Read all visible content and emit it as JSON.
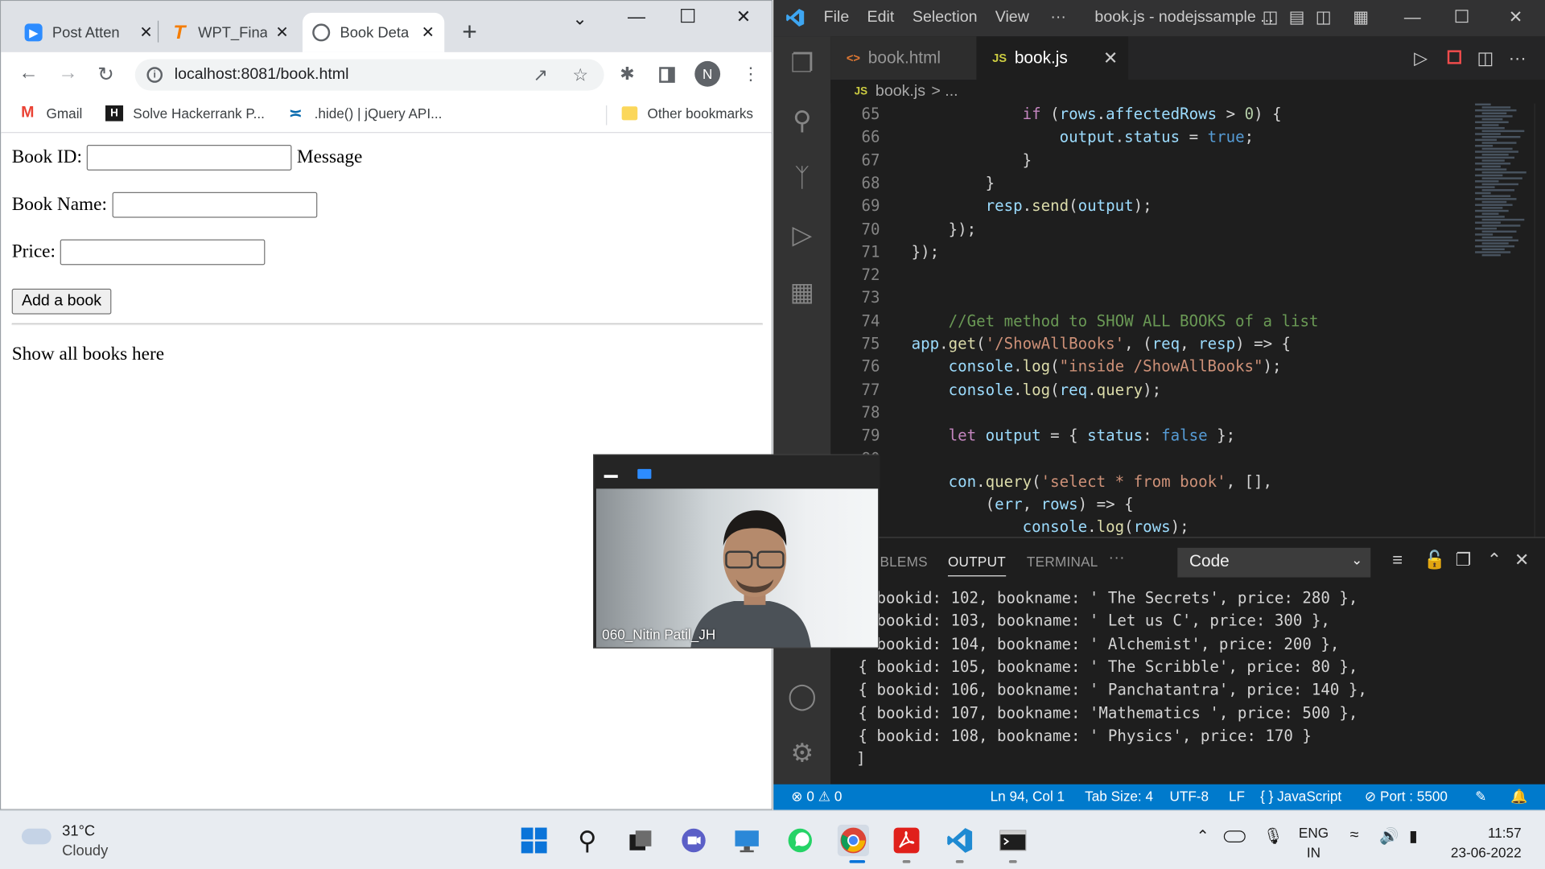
{
  "browser": {
    "tabs": [
      {
        "label": "Post Atten",
        "icon": "zoom-icon"
      },
      {
        "label": "WPT_Final",
        "icon": "testbook-icon"
      },
      {
        "label": "Book Deta",
        "icon": "globe-icon"
      }
    ],
    "url": "localhost:8081/book.html",
    "profile_initial": "N",
    "bookmarks": [
      {
        "label": "Gmail",
        "icon": "gmail-icon"
      },
      {
        "label": "Solve Hackerrank P...",
        "icon": "hackerrank-icon"
      },
      {
        "label": ".hide() | jQuery API...",
        "icon": "jquery-icon"
      }
    ],
    "other_bookmarks": "Other bookmarks"
  },
  "form": {
    "book_id_label": "Book ID:",
    "message_label": "Message",
    "book_name_label": "Book Name:",
    "price_label": "Price:",
    "book_id_value": "",
    "book_name_value": "",
    "price_value": "",
    "add_button": "Add a book",
    "show_all_text": "Show all books here"
  },
  "vscode": {
    "menu": [
      "File",
      "Edit",
      "Selection",
      "View",
      "···"
    ],
    "title": "book.js - nodejssample ...",
    "tabs": [
      {
        "label": "book.html",
        "icon": "<>"
      },
      {
        "label": "book.js",
        "icon": "JS"
      }
    ],
    "breadcrumb_file": "book.js",
    "breadcrumb_rest": "> ...",
    "code_lines": [
      {
        "n": "65",
        "text": "            if (rows.affectedRows > 0) {"
      },
      {
        "n": "66",
        "text": "                output.status = true;"
      },
      {
        "n": "67",
        "text": "            }"
      },
      {
        "n": "68",
        "text": "        }"
      },
      {
        "n": "69",
        "text": "        resp.send(output);"
      },
      {
        "n": "70",
        "text": "    });"
      },
      {
        "n": "71",
        "text": "});"
      },
      {
        "n": "72",
        "text": ""
      },
      {
        "n": "73",
        "text": ""
      },
      {
        "n": "74",
        "text": "    //Get method to SHOW ALL BOOKS of a list"
      },
      {
        "n": "75",
        "text": "app.get('/ShowAllBooks', (req, resp) => {"
      },
      {
        "n": "76",
        "text": "    console.log(\"inside /ShowAllBooks\");"
      },
      {
        "n": "77",
        "text": "    console.log(req.query);"
      },
      {
        "n": "78",
        "text": ""
      },
      {
        "n": "79",
        "text": "    let output = { status: false };"
      },
      {
        "n": "80",
        "text": ""
      },
      {
        "n": "",
        "text": "    con.query('select * from book', [],"
      },
      {
        "n": "",
        "text": "        (err, rows) => {"
      },
      {
        "n": "",
        "text": "            console.log(rows);"
      }
    ],
    "panel_tabs": [
      "BLEMS",
      "OUTPUT",
      "TERMINAL",
      "···"
    ],
    "output_channel": "Code",
    "output_lines": [
      "  bookid: 102, bookname: ' The Secrets', price: 280 },",
      "  bookid: 103, bookname: ' Let us C', price: 300 },",
      "  bookid: 104, bookname: ' Alchemist', price: 200 },",
      "{ bookid: 105, bookname: ' The Scribble', price: 80 },",
      "{ bookid: 106, bookname: ' Panchatantra', price: 140 },",
      "{ bookid: 107, bookname: 'Mathematics ', price: 500 },",
      "{ bookid: 108, bookname: ' Physics', price: 170 }",
      "]"
    ],
    "status": {
      "problems": "⊗ 0 ⚠ 0",
      "position": "Ln 94, Col 1",
      "tab_size": "Tab Size: 4",
      "encoding": "UTF-8",
      "eol": "LF",
      "language": "{ } JavaScript",
      "port": "⊘ Port : 5500"
    }
  },
  "video": {
    "participant": "060_Nitin Patil_JH"
  },
  "taskbar": {
    "temperature": "31°C",
    "weather": "Cloudy",
    "lang_line1": "ENG",
    "lang_line2": "IN",
    "time": "11:57",
    "date": "23-06-2022",
    "apps": [
      "start-icon",
      "search-icon",
      "task-view-icon",
      "teams-chat-icon",
      "remote-desktop-icon",
      "whatsapp-icon",
      "chrome-icon",
      "acrobat-icon",
      "vscode-icon",
      "terminal-icon"
    ]
  },
  "colors": {
    "vscode_accent": "#007acc",
    "chrome_tabstrip": "#dee1e6",
    "editor_bg": "#1e1e1e"
  }
}
